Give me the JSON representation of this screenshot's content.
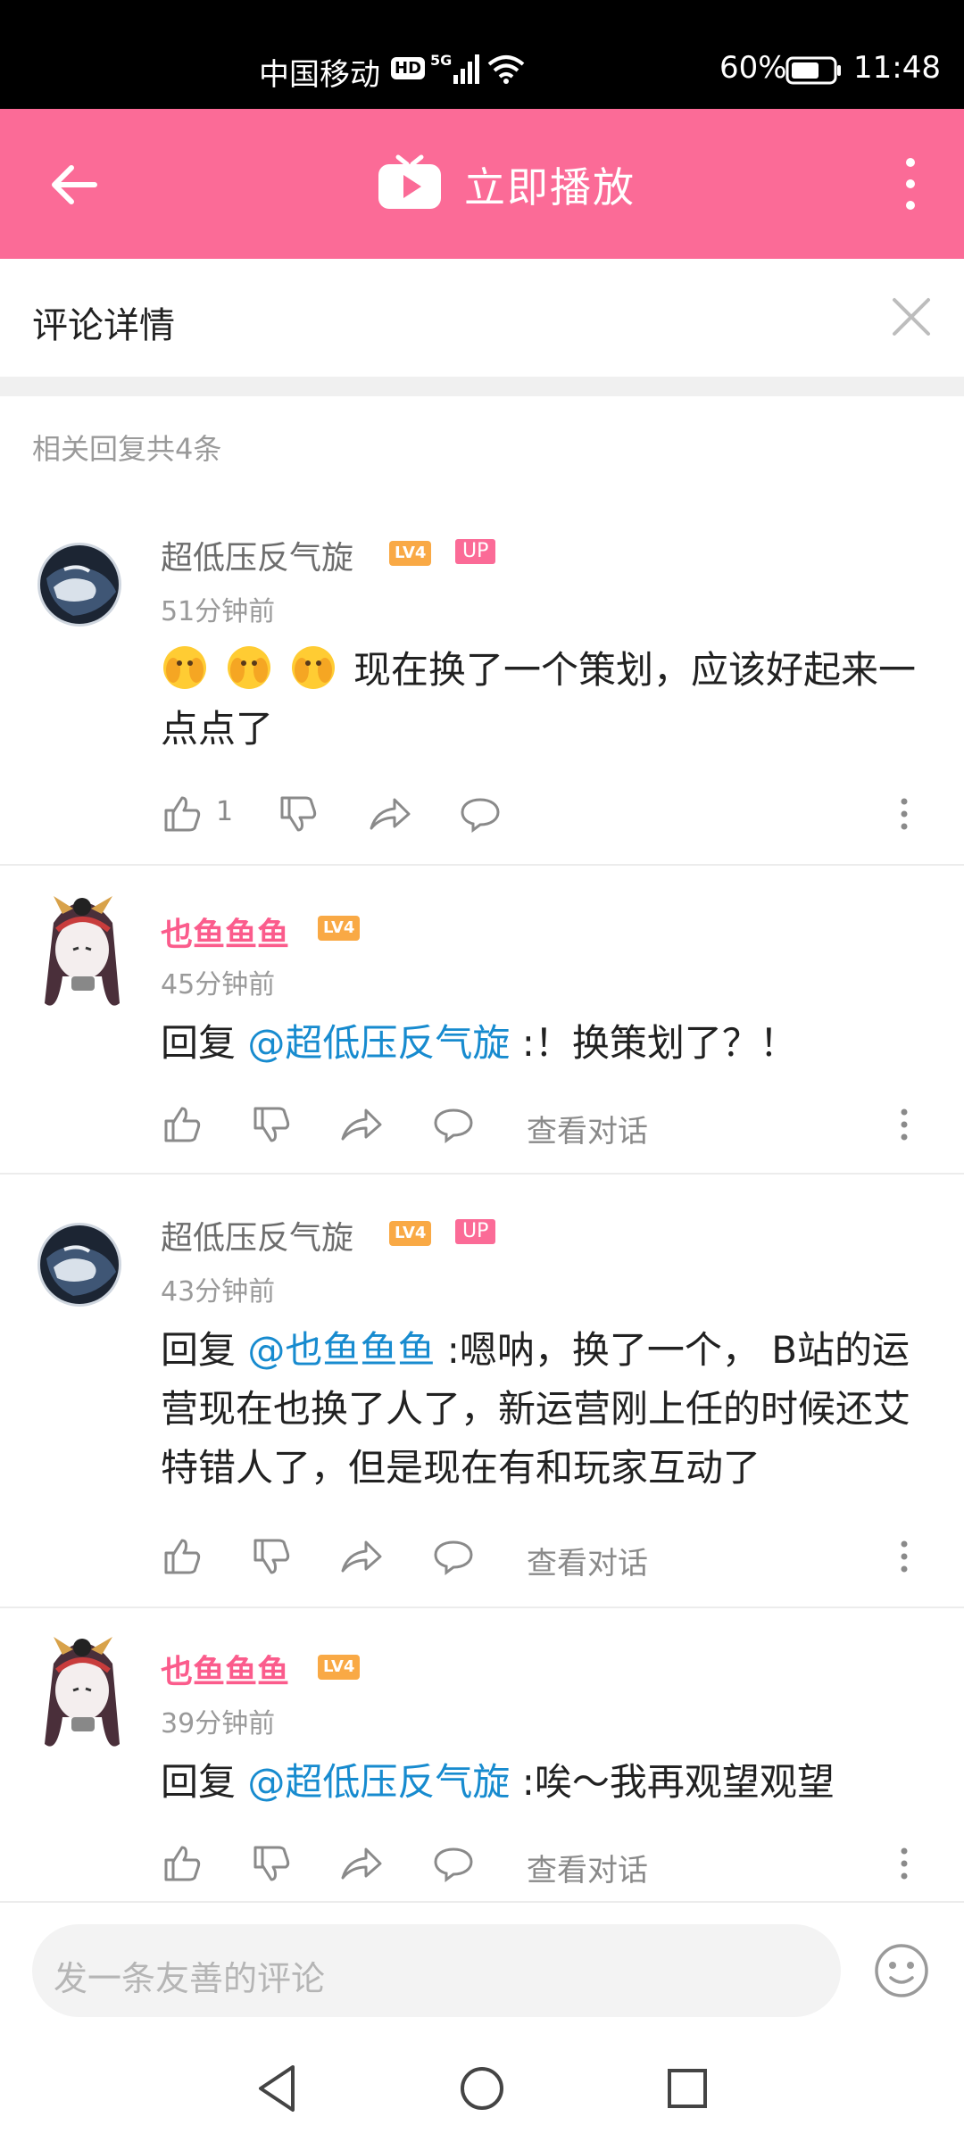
{
  "status_bar": {
    "carrier": "中国移动",
    "hd": "HD",
    "network": "5G",
    "battery": "60%",
    "time": "11:48"
  },
  "app_bar": {
    "title": "立即播放",
    "accent": "#fb6b97"
  },
  "panel": {
    "title": "评论详情"
  },
  "reply_count": "相关回复共4条",
  "comments": [
    {
      "user": "超低压反气旋",
      "level": "LV4",
      "up_badge": "UP",
      "time": "51分钟前",
      "text": "现在换了一个策划，应该好起来一点点了",
      "emojis": 3,
      "likes": "1"
    },
    {
      "user": "也鱼鱼鱼",
      "level": "LV4",
      "time": "45分钟前",
      "reply_prefix": "回复 ",
      "mention": "@超低压反气旋",
      "text": " :！换策划了？！",
      "view_conversation": "查看对话"
    },
    {
      "user": "超低压反气旋",
      "level": "LV4",
      "up_badge": "UP",
      "time": "43分钟前",
      "reply_prefix": "回复 ",
      "mention": "@也鱼鱼鱼",
      "text": " :嗯呐，换了一个， B站的运营现在也换了人了，新运营刚上任的时候还艾特错人了，但是现在有和玩家互动了",
      "view_conversation": "查看对话"
    },
    {
      "user": "也鱼鱼鱼",
      "level": "LV4",
      "time": "39分钟前",
      "reply_prefix": "回复 ",
      "mention": "@超低压反气旋",
      "text": " :唉～我再观望观望",
      "view_conversation": "查看对话"
    }
  ],
  "input": {
    "placeholder": "发一条友善的评论"
  },
  "colors": {
    "mention": "#178bcf",
    "vip_name": "#fb5c8c",
    "level_badge": "#f9a945"
  }
}
